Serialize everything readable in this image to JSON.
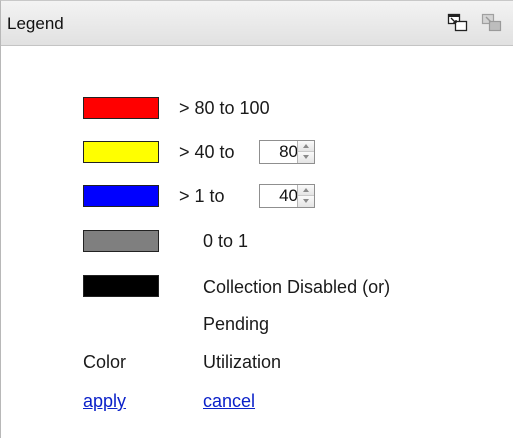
{
  "header": {
    "title": "Legend"
  },
  "colors": {
    "high": "#ff0000",
    "mid": "#ffff00",
    "low": "#0000ff",
    "zero": "#7f7f7f",
    "disabled": "#000000"
  },
  "legend": {
    "row_high": {
      "text": "> 80 to 100"
    },
    "row_mid": {
      "prefix": "> 40 to",
      "value": "80"
    },
    "row_low": {
      "prefix": "> 1 to",
      "value": "40"
    },
    "row_zero": {
      "text": "0 to 1"
    },
    "row_disabled": {
      "line1": "Collection Disabled (or)",
      "line2": "Pending"
    }
  },
  "columns": {
    "color": "Color",
    "utilization": "Utilization"
  },
  "actions": {
    "apply": "apply",
    "cancel": "cancel"
  }
}
